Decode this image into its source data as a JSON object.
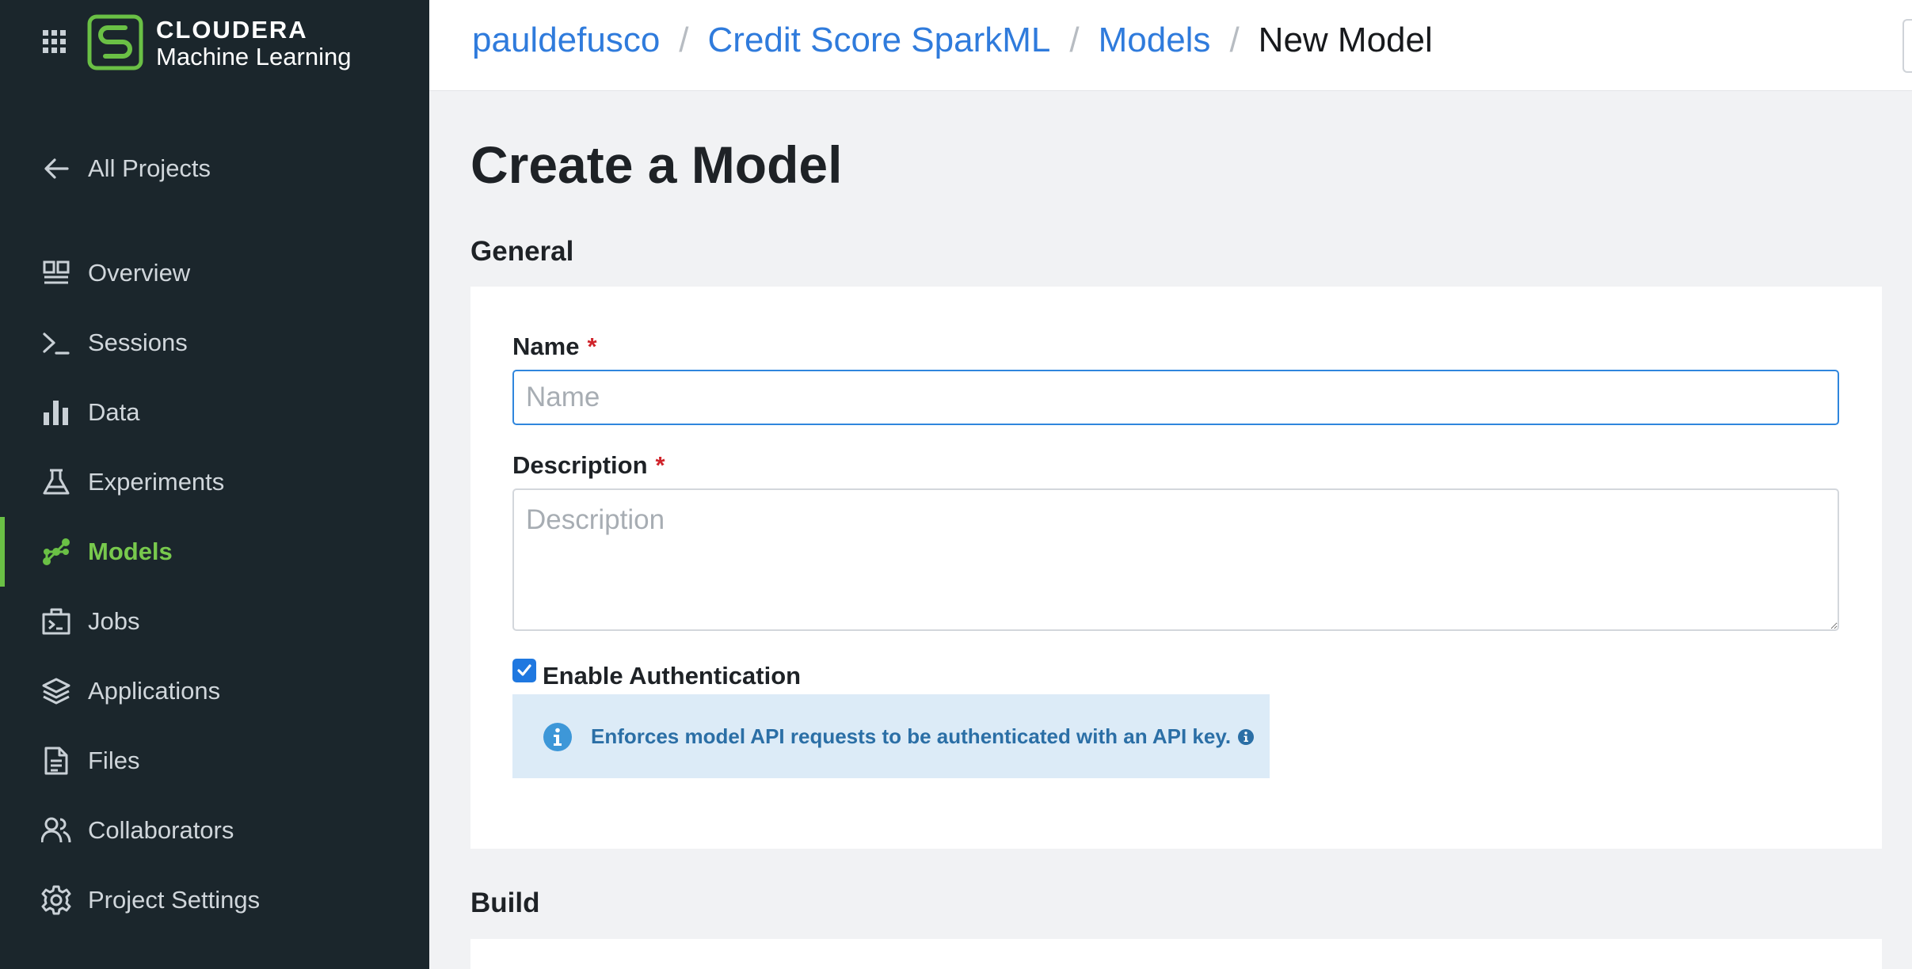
{
  "brand": {
    "line1": "CLOUDERA",
    "line2": "Machine Learning",
    "accent_color": "#6ac045"
  },
  "sidebar": {
    "back_label": "All Projects",
    "items": [
      {
        "label": "Overview",
        "icon": "overview-icon"
      },
      {
        "label": "Sessions",
        "icon": "terminal-icon"
      },
      {
        "label": "Data",
        "icon": "bar-chart-icon"
      },
      {
        "label": "Experiments",
        "icon": "flask-icon"
      },
      {
        "label": "Models",
        "icon": "model-graph-icon",
        "active": true
      },
      {
        "label": "Jobs",
        "icon": "jobs-icon"
      },
      {
        "label": "Applications",
        "icon": "layers-icon"
      },
      {
        "label": "Files",
        "icon": "file-icon"
      },
      {
        "label": "Collaborators",
        "icon": "users-icon"
      },
      {
        "label": "Project Settings",
        "icon": "gear-icon"
      }
    ]
  },
  "breadcrumb": {
    "user": "pauldefusco",
    "project": "Credit Score SparkML",
    "section": "Models",
    "current": "New Model",
    "separator": "/",
    "link_color": "#2f7bdc"
  },
  "page": {
    "title": "Create a Model",
    "general_heading": "General",
    "build_heading": "Build"
  },
  "form": {
    "name_label": "Name",
    "name_placeholder": "Name",
    "name_value": "",
    "description_label": "Description",
    "description_placeholder": "Description",
    "description_value": "",
    "required_mark": "*",
    "auth_label": "Enable Authentication",
    "auth_checked": true,
    "auth_info": "Enforces model API requests to be authenticated with an API key."
  }
}
